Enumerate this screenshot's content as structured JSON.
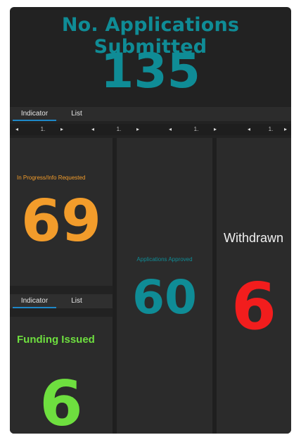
{
  "header": {
    "title": "No. Applications Submitted",
    "value": "135"
  },
  "tabs_top": [
    "Indicator",
    "List"
  ],
  "tabs_bottom": [
    "Indicator",
    "List"
  ],
  "pager": {
    "prev": "◂",
    "page": "1.",
    "next": "▸"
  },
  "panels": {
    "in_progress": {
      "label": "In Progress/Info Requested",
      "value": "69"
    },
    "approved": {
      "label": "Applications Approved",
      "value": "60"
    },
    "withdrawn": {
      "label": "Withdrawn",
      "value": "6"
    },
    "funding": {
      "label": "Funding Issued",
      "value": "6"
    }
  },
  "colors": {
    "teal": "#0f8c96",
    "orange": "#f29c2b",
    "red": "#f21d1d",
    "green": "#6edf3f",
    "white": "#f0f0f0",
    "tab_active": "#1e88c8"
  }
}
